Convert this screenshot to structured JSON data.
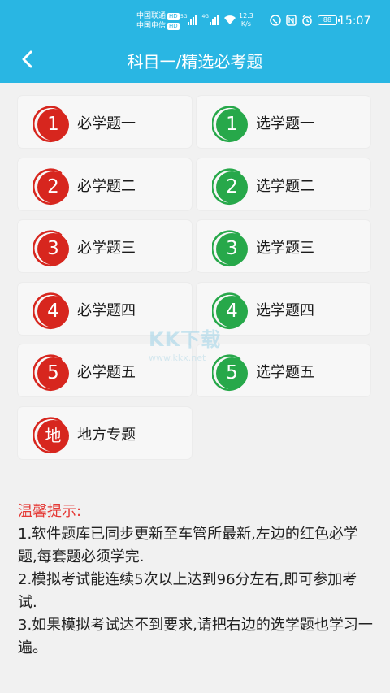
{
  "status_bar": {
    "carrier1": "中国联通",
    "carrier2": "中国电信",
    "hd": "HD",
    "net_gen1": "5G",
    "net_gen2": "4G",
    "speed_value": "12.3",
    "speed_unit": "K/s",
    "battery": "88",
    "time": "15:07"
  },
  "header": {
    "back_icon": "chevron-left-icon",
    "title": "科目一/精选必考题"
  },
  "colors": {
    "header": "#29b6e3",
    "red_badge": "#d7261e",
    "green_badge": "#27a84a",
    "tip_title": "#e53935"
  },
  "cards": [
    {
      "badge": "1",
      "label": "必学题一",
      "color": "red"
    },
    {
      "badge": "1",
      "label": "选学题一",
      "color": "green"
    },
    {
      "badge": "2",
      "label": "必学题二",
      "color": "red"
    },
    {
      "badge": "2",
      "label": "选学题二",
      "color": "green"
    },
    {
      "badge": "3",
      "label": "必学题三",
      "color": "red"
    },
    {
      "badge": "3",
      "label": "选学题三",
      "color": "green"
    },
    {
      "badge": "4",
      "label": "必学题四",
      "color": "red"
    },
    {
      "badge": "4",
      "label": "选学题四",
      "color": "green"
    },
    {
      "badge": "5",
      "label": "必学题五",
      "color": "red"
    },
    {
      "badge": "5",
      "label": "选学题五",
      "color": "green"
    },
    {
      "badge": "地",
      "label": "地方专题",
      "color": "red"
    }
  ],
  "watermark": {
    "big": "KK下载",
    "small": "www.kkx.net"
  },
  "tips": {
    "title": "温馨提示:",
    "lines": [
      "1.软件题库已同步更新至车管所最新,左边的红色必学题,每套题必须学完.",
      "2.模拟考试能连续5次以上达到96分左右,即可参加考试.",
      "3.如果模拟考试达不到要求,请把右边的选学题也学习一遍。"
    ]
  }
}
